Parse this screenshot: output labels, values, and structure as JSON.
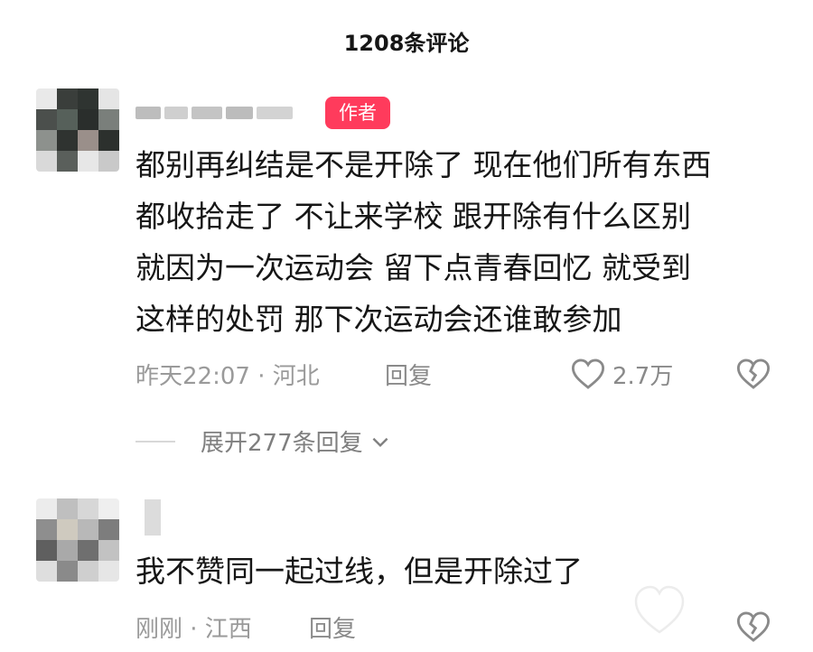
{
  "header": {
    "title": "1208条评论"
  },
  "comments": [
    {
      "author_badge": "作者",
      "text_lines": [
        "都别再纠结是不是开除了 现在他们所有东西",
        "都收拾走了 不让来学校 跟开除有什么区别",
        "就因为一次运动会  留下点青春回忆 就受到",
        "这样的处罚 那下次运动会还谁敢参加"
      ],
      "time_location": "昨天22:07 · 河北",
      "reply_label": "回复",
      "like_count": "2.7万",
      "expand_replies": "展开277条回复"
    },
    {
      "text_lines": [
        "我不赞同一起过线，但是开除过了"
      ],
      "time_location": "刚刚 · 江西",
      "reply_label": "回复"
    }
  ],
  "icons": {
    "like": "heart-outline-icon",
    "dislike": "broken-heart-icon",
    "expand": "chevron-down-icon"
  },
  "colors": {
    "badge": "#ff3b5c",
    "meta": "#9a9a9a"
  }
}
